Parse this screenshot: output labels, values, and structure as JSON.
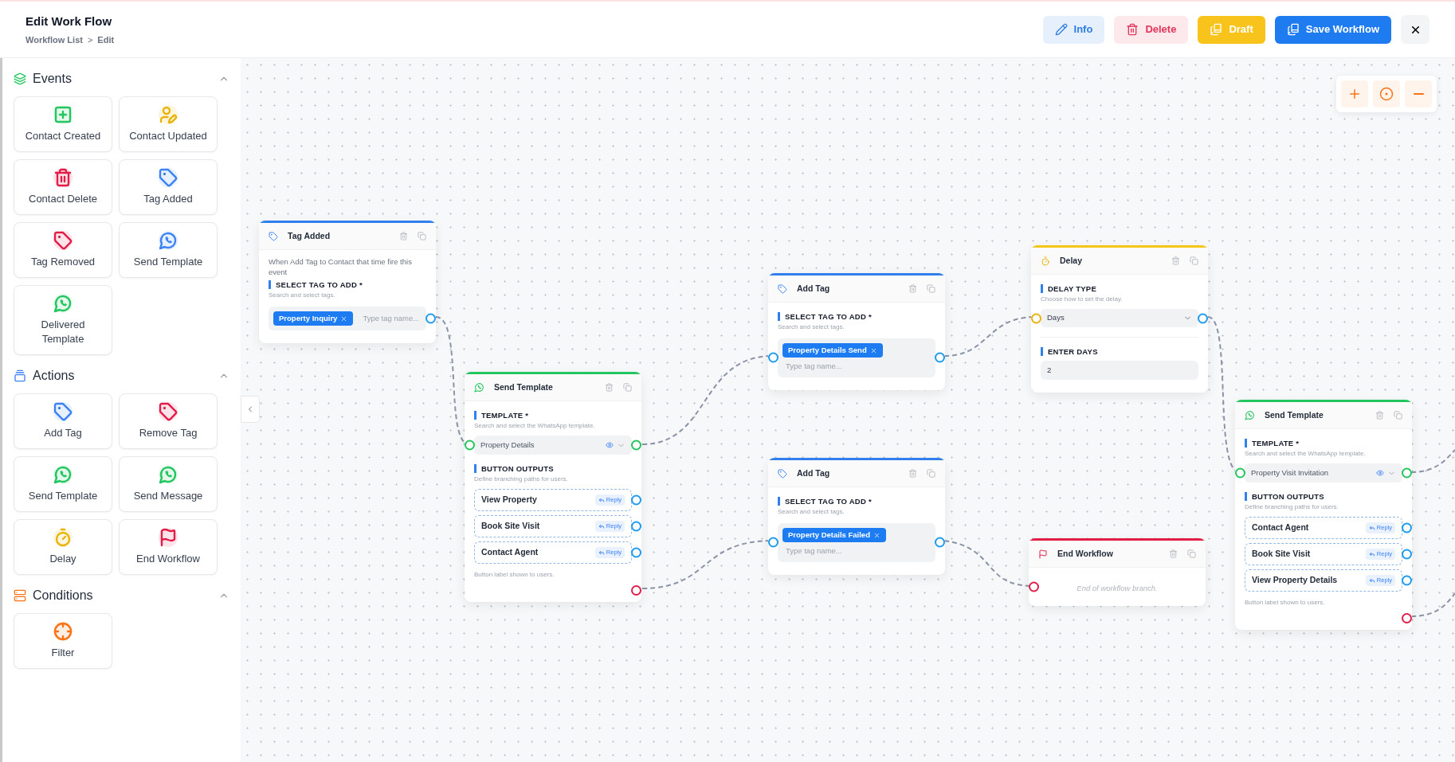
{
  "header": {
    "title": "Edit Work Flow",
    "breadcrumb": [
      "Workflow List",
      "Edit"
    ],
    "separator": ">"
  },
  "toolbar": [
    {
      "kind": "info",
      "label": "Info"
    },
    {
      "kind": "delete",
      "label": "Delete"
    },
    {
      "kind": "draft",
      "label": "Draft"
    },
    {
      "kind": "save",
      "label": "Save Workflow"
    },
    {
      "kind": "close"
    }
  ],
  "sidebar": {
    "sections": [
      {
        "kind": "events",
        "title": "Events",
        "expanded": true,
        "items": [
          {
            "kind": "contact_created",
            "label": "Contact Created",
            "color": "#22c55e"
          },
          {
            "kind": "contact_updated",
            "label": "Contact Updated",
            "color": "#eab308"
          },
          {
            "kind": "contact_delete",
            "label": "Contact Delete",
            "color": "#e11d48"
          },
          {
            "kind": "tag",
            "label": "Tag Added",
            "color": "#3b82f6"
          },
          {
            "kind": "tag",
            "label": "Tag Removed",
            "color": "#e11d48"
          },
          {
            "kind": "template",
            "label": "Send Template",
            "color": "#3b82f6"
          },
          {
            "kind": "template",
            "label": "Delivered Template",
            "color": "#22c55e"
          }
        ]
      },
      {
        "kind": "actions",
        "title": "Actions",
        "expanded": true,
        "items": [
          {
            "kind": "tag",
            "label": "Add Tag",
            "color": "#3b82f6"
          },
          {
            "kind": "tag",
            "label": "Remove Tag",
            "color": "#e11d48"
          },
          {
            "kind": "template",
            "label": "Send Template",
            "color": "#22c55e"
          },
          {
            "kind": "template",
            "label": "Send Message",
            "color": "#22c55e"
          },
          {
            "kind": "delay",
            "label": "Delay",
            "color": "#eab308"
          },
          {
            "kind": "end",
            "label": "End Workflow",
            "color": "#e11d48"
          }
        ]
      },
      {
        "kind": "conditions",
        "title": "Conditions",
        "expanded": true,
        "items": [
          {
            "kind": "filter",
            "label": "Filter",
            "color": "#f97316"
          }
        ]
      }
    ]
  },
  "nodes": [
    {
      "kind": "tag_added",
      "title": "Tag Added",
      "description": "When Add Tag to Contact that time fire this event",
      "field_label": "SELECT TAG TO ADD *",
      "field_hint": "Search and select tags.",
      "tags": [
        "Property Inquiry"
      ],
      "placeholder": "Type tag name..."
    },
    {
      "kind": "send_template",
      "title": "Send Template",
      "template_label": "TEMPLATE *",
      "template_hint": "Search and select the WhatsApp template.",
      "template_value": "Property Details",
      "outputs_label": "BUTTON OUTPUTS",
      "outputs_hint": "Define branching paths for users.",
      "buttons": [
        {
          "label": "View Property",
          "badge": "Reply"
        },
        {
          "label": "Book Site Visit",
          "badge": "Reply"
        },
        {
          "label": "Contact Agent",
          "badge": "Reply"
        }
      ],
      "footer": "Button label shown to users."
    },
    {
      "kind": "add_tag",
      "title": "Add Tag",
      "field_label": "SELECT TAG TO ADD *",
      "field_hint": "Search and select tags.",
      "tags": [
        "Property Details Send"
      ],
      "placeholder": "Type tag name..."
    },
    {
      "kind": "add_tag",
      "title": "Add Tag",
      "field_label": "SELECT TAG TO ADD *",
      "field_hint": "Search and select tags.",
      "tags": [
        "Property Details Failed"
      ],
      "placeholder": "Type tag name..."
    },
    {
      "kind": "delay",
      "title": "Delay",
      "type_label": "DELAY TYPE",
      "type_hint": "Choose how to set the delay.",
      "type_value": "Days",
      "days_label": "ENTER DAYS",
      "days_value": "2"
    },
    {
      "kind": "end",
      "title": "End Workflow",
      "note": "End of workflow branch."
    },
    {
      "kind": "send_template",
      "title": "Send Template",
      "template_label": "TEMPLATE *",
      "template_hint": "Search and select the WhatsApp template.",
      "template_value": "Property Visit Invitation",
      "outputs_label": "BUTTON OUTPUTS",
      "outputs_hint": "Define branching paths for users.",
      "buttons": [
        {
          "label": "Contact Agent",
          "badge": "Reply"
        },
        {
          "label": "Book Site Visit",
          "badge": "Reply"
        },
        {
          "label": "View Property Details",
          "badge": "Reply"
        }
      ],
      "footer": "Button label shown to users."
    }
  ]
}
